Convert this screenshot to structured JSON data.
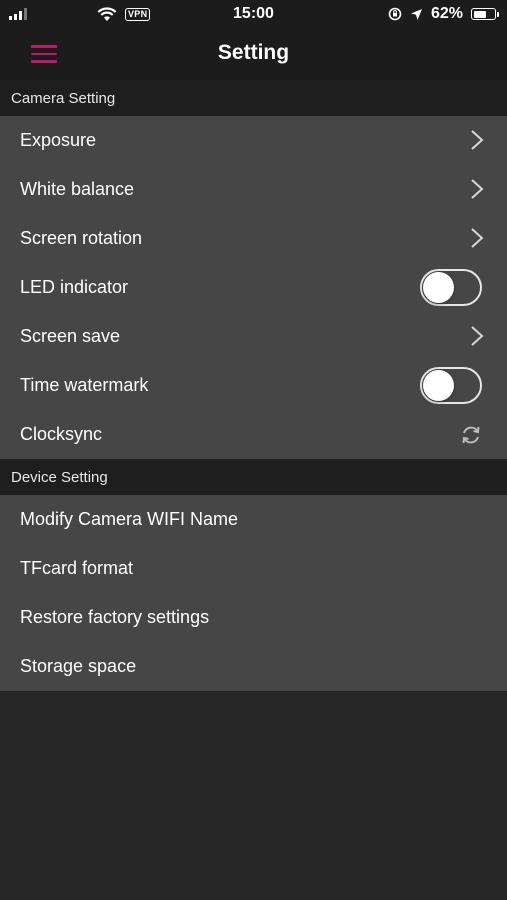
{
  "status_bar": {
    "time": "15:00",
    "vpn": "VPN",
    "battery": "62%",
    "battery_level": 0.62
  },
  "nav": {
    "title": "Setting",
    "menu_icon": "hamburger-menu-icon",
    "accent_color": "#c2186b"
  },
  "camera_section": {
    "title": "Camera Setting",
    "items": [
      {
        "label": "Exposure",
        "control": "chevron"
      },
      {
        "label": "White balance",
        "control": "chevron"
      },
      {
        "label": "Screen rotation",
        "control": "chevron"
      },
      {
        "label": "LED indicator",
        "control": "toggle",
        "on": false
      },
      {
        "label": "Screen save",
        "control": "chevron"
      },
      {
        "label": "Time watermark",
        "control": "toggle",
        "on": false
      },
      {
        "label": "Clocksync",
        "control": "sync-icon"
      }
    ]
  },
  "device_section": {
    "title": "Device Setting",
    "items": [
      {
        "label": "Modify Camera WIFI Name"
      },
      {
        "label": "TFcard format"
      },
      {
        "label": "Restore factory settings"
      },
      {
        "label": "Storage space"
      }
    ]
  },
  "colors": {
    "background": "#262626",
    "bar": "#1c1c1c",
    "row_bg": "#464646",
    "section_header_bg": "#1e1e1e"
  }
}
